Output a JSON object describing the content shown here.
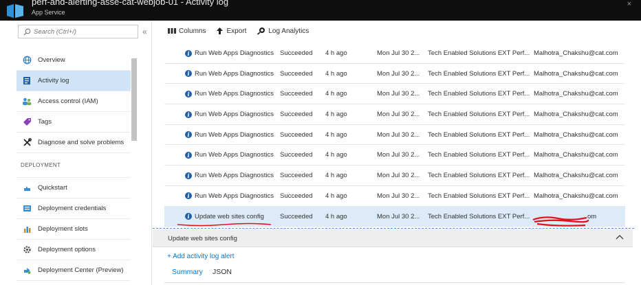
{
  "window": {
    "title": "perf-and-alerting-asse-cat-webjob-01 - Activity log",
    "subtitle": "App Service",
    "corner": "×"
  },
  "sidebar": {
    "search_placeholder": "Search (Ctrl+/)",
    "collapse": "«",
    "items": [
      {
        "label": "Overview",
        "icon": "globe-icon"
      },
      {
        "label": "Activity log",
        "icon": "log-icon",
        "active": true
      },
      {
        "label": "Access control (IAM)",
        "icon": "people-icon"
      },
      {
        "label": "Tags",
        "icon": "tag-icon"
      },
      {
        "label": "Diagnose and solve problems",
        "icon": "wrench-icon"
      }
    ],
    "section": "DEPLOYMENT",
    "deployment_items": [
      {
        "label": "Quickstart",
        "icon": "cloud-icon"
      },
      {
        "label": "Deployment credentials",
        "icon": "credentials-icon"
      },
      {
        "label": "Deployment slots",
        "icon": "slots-icon"
      },
      {
        "label": "Deployment options",
        "icon": "gear-icon"
      },
      {
        "label": "Deployment Center (Preview)",
        "icon": "center-icon"
      }
    ]
  },
  "toolbar": {
    "columns": "Columns",
    "export": "Export",
    "log_analytics": "Log Analytics"
  },
  "rows": [
    {
      "op": "Run Web Apps Diagnostics",
      "status": "Succeeded",
      "time": "4 h ago",
      "date": "Mon Jul 30 2...",
      "sub": "Tech Enabled Solutions EXT Perf...",
      "by": "Malhotra_Chakshu@cat.com"
    },
    {
      "op": "Run Web Apps Diagnostics",
      "status": "Succeeded",
      "time": "4 h ago",
      "date": "Mon Jul 30 2...",
      "sub": "Tech Enabled Solutions EXT Perf...",
      "by": "Malhotra_Chakshu@cat.com"
    },
    {
      "op": "Run Web Apps Diagnostics",
      "status": "Succeeded",
      "time": "4 h ago",
      "date": "Mon Jul 30 2...",
      "sub": "Tech Enabled Solutions EXT Perf...",
      "by": "Malhotra_Chakshu@cat.com"
    },
    {
      "op": "Run Web Apps Diagnostics",
      "status": "Succeeded",
      "time": "4 h ago",
      "date": "Mon Jul 30 2...",
      "sub": "Tech Enabled Solutions EXT Perf...",
      "by": "Malhotra_Chakshu@cat.com"
    },
    {
      "op": "Run Web Apps Diagnostics",
      "status": "Succeeded",
      "time": "4 h ago",
      "date": "Mon Jul 30 2...",
      "sub": "Tech Enabled Solutions EXT Perf...",
      "by": "Malhotra_Chakshu@cat.com"
    },
    {
      "op": "Run Web Apps Diagnostics",
      "status": "Succeeded",
      "time": "4 h ago",
      "date": "Mon Jul 30 2...",
      "sub": "Tech Enabled Solutions EXT Perf...",
      "by": "Malhotra_Chakshu@cat.com"
    },
    {
      "op": "Run Web Apps Diagnostics",
      "status": "Succeeded",
      "time": "4 h ago",
      "date": "Mon Jul 30 2...",
      "sub": "Tech Enabled Solutions EXT Perf...",
      "by": "Malhotra_Chakshu@cat.com"
    },
    {
      "op": "Run Web Apps Diagnostics",
      "status": "Succeeded",
      "time": "4 h ago",
      "date": "Mon Jul 30 2...",
      "sub": "Tech Enabled Solutions EXT Perf...",
      "by": "Malhotra_Chakshu@cat.com"
    },
    {
      "op": "Update web sites config",
      "status": "Succeeded",
      "time": "4 h ago",
      "date": "Mon Jul 30 2...",
      "sub": "Tech Enabled Solutions EXT Perf...",
      "by": "om"
    }
  ],
  "detail": {
    "title": "Update web sites config",
    "add_alert": "+ Add activity log alert",
    "tabs": [
      "Summary",
      "JSON"
    ]
  },
  "colors": {
    "accent": "#0078d4",
    "selected_row": "#dcebf7",
    "active_nav": "#cfe4f8",
    "annotation_red": "#e0141e"
  }
}
